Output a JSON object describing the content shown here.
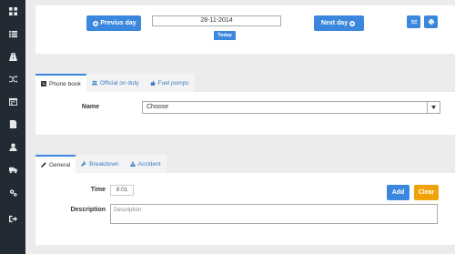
{
  "sidebar": {
    "items": [
      {
        "icon": "grid-icon"
      },
      {
        "icon": "list-icon"
      },
      {
        "icon": "road-icon"
      },
      {
        "icon": "shuffle-icon"
      },
      {
        "icon": "calendar-icon"
      },
      {
        "icon": "document-icon"
      },
      {
        "icon": "user-icon"
      },
      {
        "icon": "truck-icon"
      },
      {
        "icon": "gears-icon"
      },
      {
        "icon": "sign-out-icon"
      }
    ]
  },
  "datebar": {
    "prev_label": "Previus day",
    "date_value": "28-11-2014",
    "today_label": "Today",
    "next_label": "Next day"
  },
  "tabs1": {
    "items": [
      {
        "label": "Phone book",
        "icon": "phone-icon"
      },
      {
        "label": "Official on duty",
        "icon": "users-icon"
      },
      {
        "label": "Fuel pumps",
        "icon": "fire-icon"
      }
    ]
  },
  "phonebook": {
    "name_label": "Name",
    "select_value": "Choose"
  },
  "tabs2": {
    "items": [
      {
        "label": "General",
        "icon": "pencil-icon"
      },
      {
        "label": "Breakdown",
        "icon": "wrench-icon"
      },
      {
        "label": "Accident",
        "icon": "warning-icon"
      }
    ]
  },
  "general": {
    "time_label": "Time",
    "time_value": "8:01",
    "description_label": "Description",
    "description_placeholder": "Description",
    "add_label": "Add",
    "clear_label": "Clear"
  },
  "colors": {
    "sidebar": "#222b33",
    "primary": "#3a87dd",
    "warning": "#f0a20a"
  }
}
